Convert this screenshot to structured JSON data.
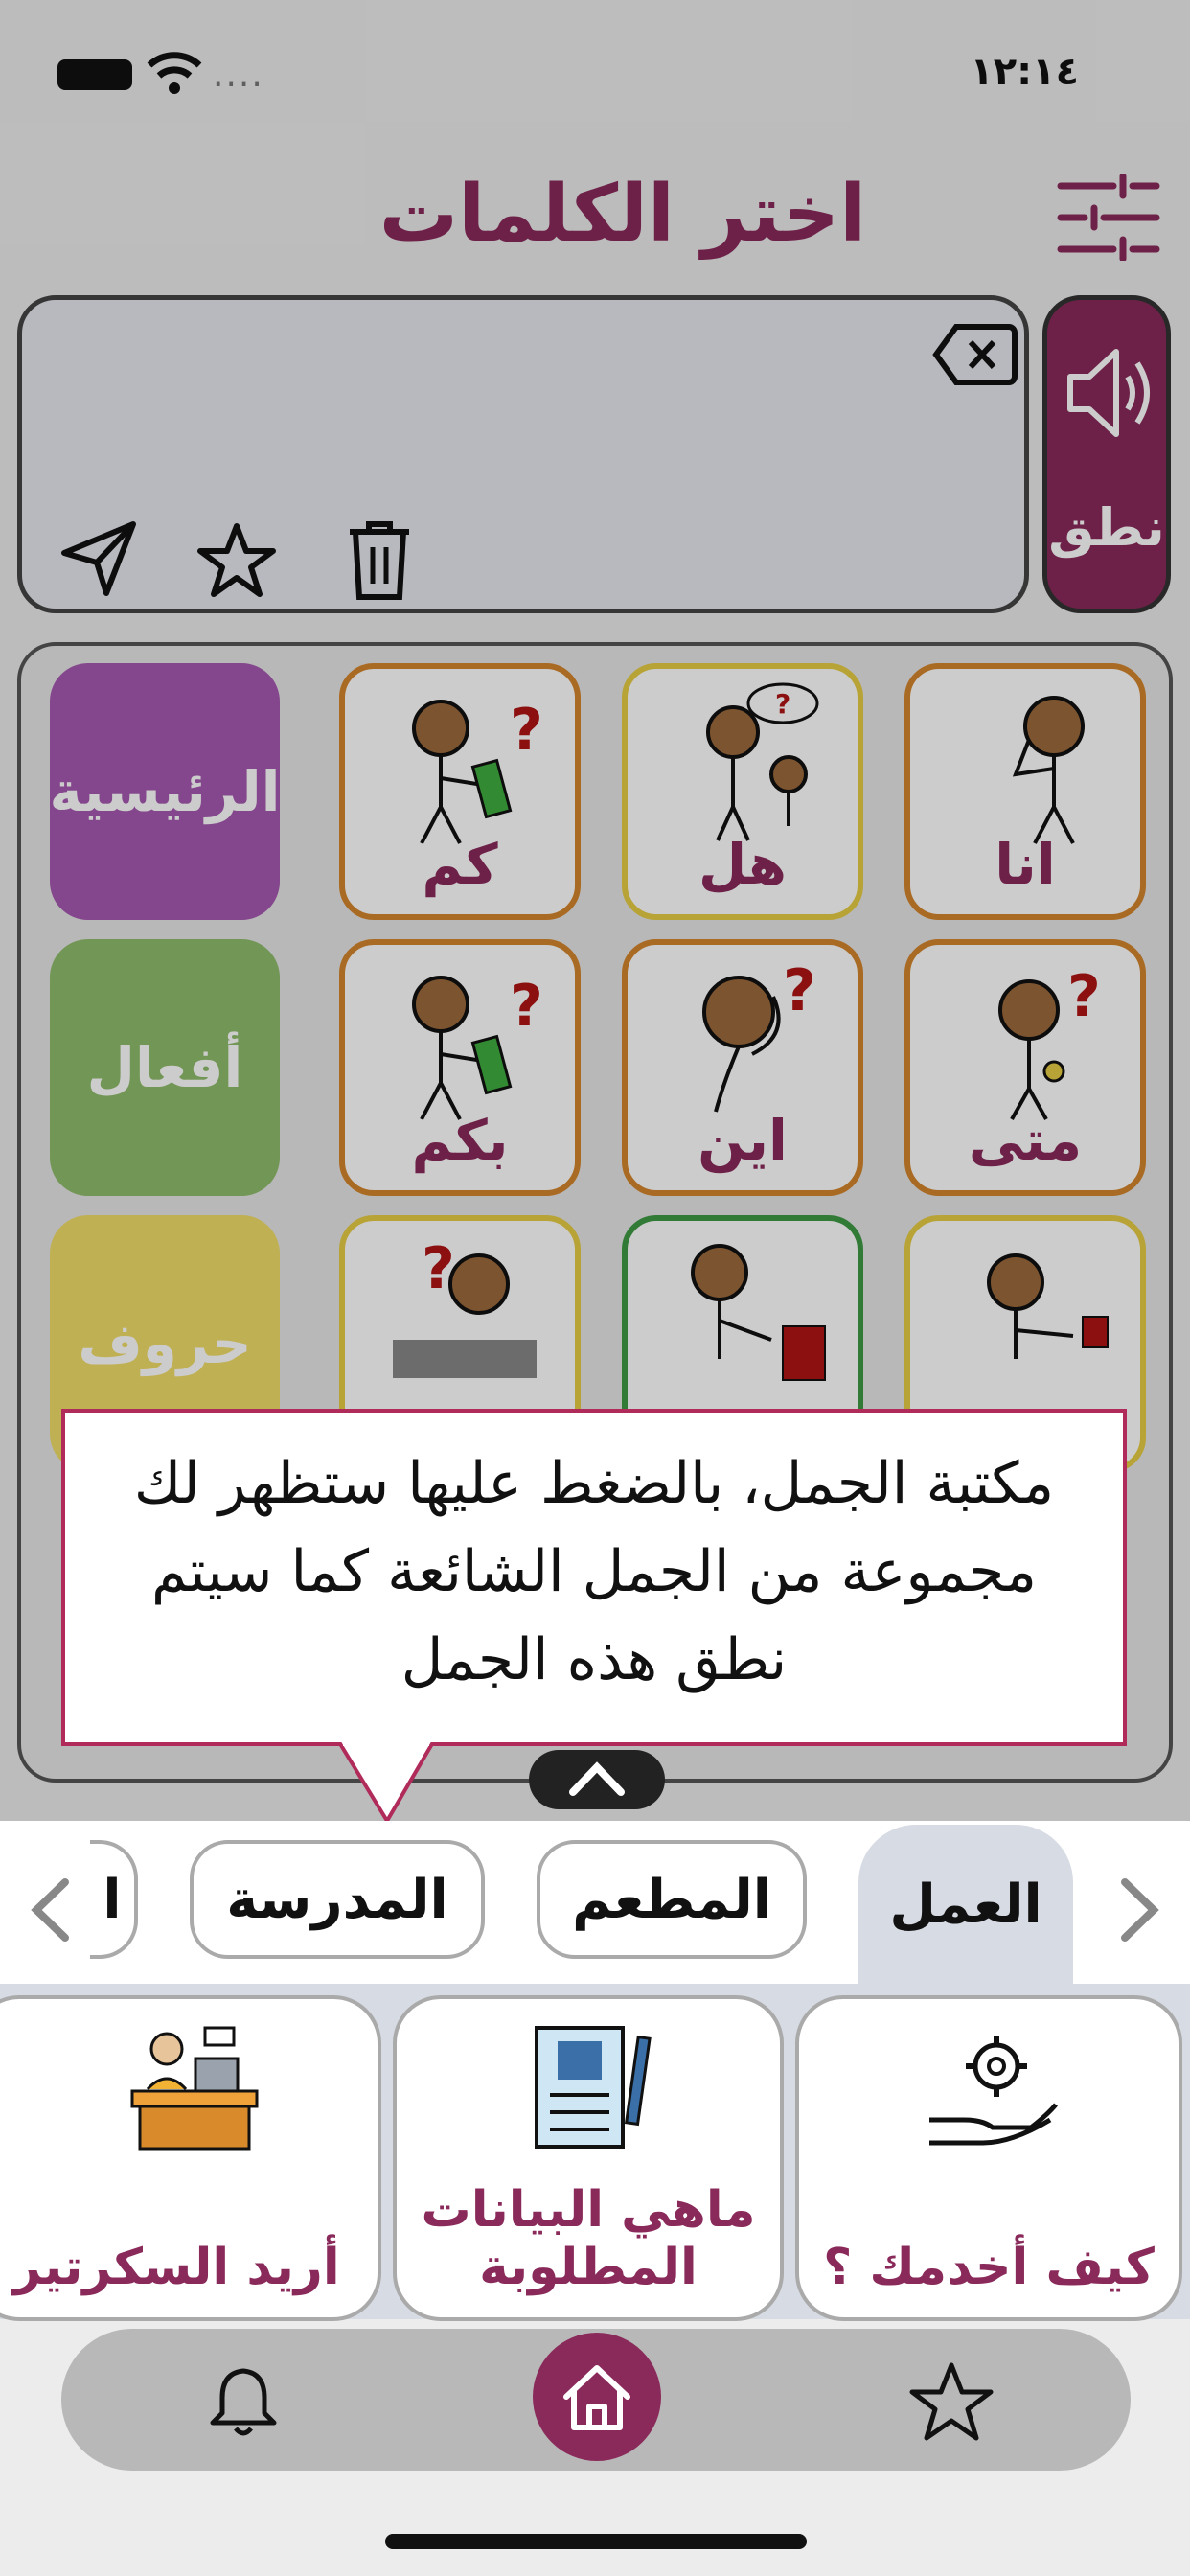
{
  "status_bar": {
    "time": "١٢:١٤",
    "signal_dots": "...."
  },
  "header": {
    "title": "اختر الكلمات"
  },
  "speak_button": {
    "label": "نطق"
  },
  "grid": {
    "row1": {
      "c1": "انا",
      "c2": "هل",
      "c3": "كم"
    },
    "row2": {
      "c1": "متى",
      "c2": "اين",
      "c3": "بكم"
    }
  },
  "categories": {
    "main": "الرئيسية",
    "verbs": "أفعال",
    "letters": "حروف"
  },
  "tooltip": {
    "text": "مكتبة الجمل، بالضغط عليها ستظهر لك مجموعة من الجمل الشائعة كما سيتم نطق هذه الجمل"
  },
  "chips": {
    "work": "العمل",
    "restaurant": "المطعم",
    "school": "المدرسة",
    "partial": "ا"
  },
  "phrases": {
    "p1": "كيف أخدمك ؟",
    "p2": "ماهي البيانات المطلوبة",
    "p3": "أريد السكرتير"
  },
  "colors": {
    "primary": "#8a2a5a",
    "main_category": "#a658b0",
    "verbs_category": "#8fbc6c",
    "letters_category": "#f0dc6a"
  }
}
